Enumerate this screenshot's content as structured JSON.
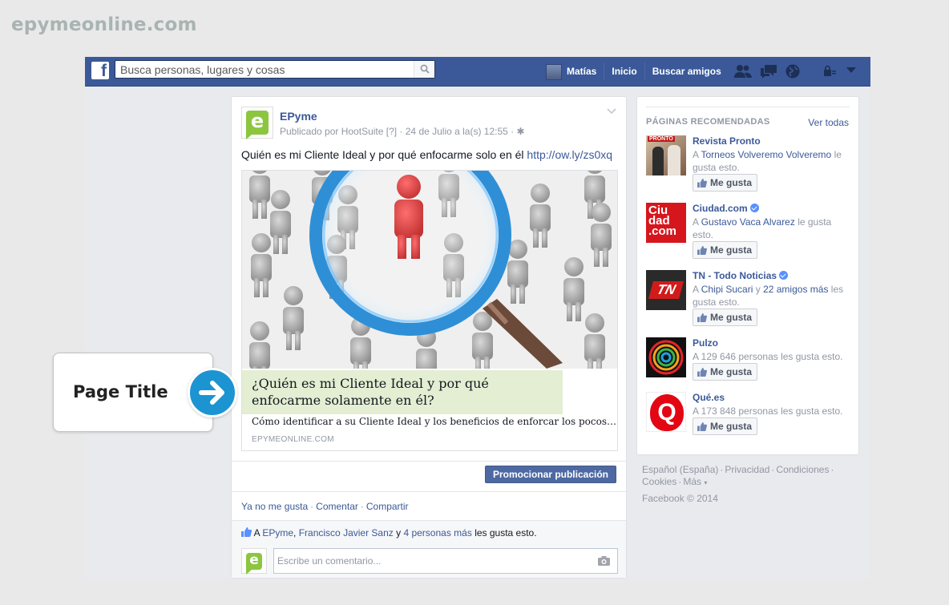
{
  "brand": "epymeonline.com",
  "topbar": {
    "search_placeholder": "Busca personas, lugares y cosas",
    "user_name": "Matías",
    "home": "Inicio",
    "find_friends": "Buscar amigos"
  },
  "post": {
    "page_name": "EPyme",
    "meta": "Publicado por HootSuite [?] · 24 de Julio a la(s) 12:55 ·",
    "text": "Quién es mi Cliente Ideal y por qué enfocarme solo en él",
    "link": "http://ow.ly/zs0xq",
    "card": {
      "title": "¿Quién es mi Cliente Ideal y por qué enfocarme solamente en él?",
      "description": "Cómo identificar a su Cliente Ideal y los beneficios de enforcar los pocos…",
      "domain": "EPYMEONLINE.COM"
    },
    "promote": "Promocionar publicación",
    "actions": {
      "unlike": "Ya no me gusta",
      "comment": "Comentar",
      "share": "Compartir"
    },
    "likes": {
      "prefix": "A",
      "name1": "EPyme",
      "name2": "Francisco Javier Sanz",
      "connector": "y",
      "others": "4 personas más",
      "suffix": "les gusta esto."
    },
    "comment_placeholder": "Escribe un comentario..."
  },
  "sidebar": {
    "title": "PÁGINAS RECOMENDADAS",
    "see_all": "Ver todas",
    "like_label": "Me gusta",
    "pages": [
      {
        "name": "Revista Pronto",
        "pre": "A",
        "link1": "Torneos Volveremo Volveremo",
        "mid": "",
        "link2": "",
        "post": "le gusta esto.",
        "verified": false
      },
      {
        "name": "Ciudad.com",
        "pre": "A",
        "link1": "Gustavo Vaca Alvarez",
        "mid": "",
        "link2": "",
        "post": "le gusta esto.",
        "verified": true
      },
      {
        "name": "TN - Todo Noticias",
        "pre": "A",
        "link1": "Chipi Sucari",
        "mid": "y",
        "link2": "22 amigos más",
        "post": "les gusta esto.",
        "verified": true
      },
      {
        "name": "Pulzo",
        "pre": "A 129 646 personas les gusta esto.",
        "link1": "",
        "mid": "",
        "link2": "",
        "post": "",
        "verified": false
      },
      {
        "name": "Qué.es",
        "pre": "A 173 848 personas les gusta esto.",
        "link1": "",
        "mid": "",
        "link2": "",
        "post": "",
        "verified": false
      }
    ],
    "thumb_texts": {
      "ciudad": [
        "Ciu",
        "dad",
        ".com"
      ],
      "tn": "TN",
      "que": "Q",
      "pronto": "PRONTO"
    }
  },
  "footer": {
    "lang": "Español (España)",
    "privacy": "Privacidad",
    "terms": "Condiciones",
    "cookies": "Cookies",
    "more": "Más",
    "copyright": "Facebook © 2014"
  },
  "callout": {
    "label": "Page Title"
  },
  "colors": {
    "facebook_blue": "#3b5998",
    "highlight": "#e3eed2",
    "arrow": "#1c94d2",
    "epyme_green": "#8cc63f"
  }
}
